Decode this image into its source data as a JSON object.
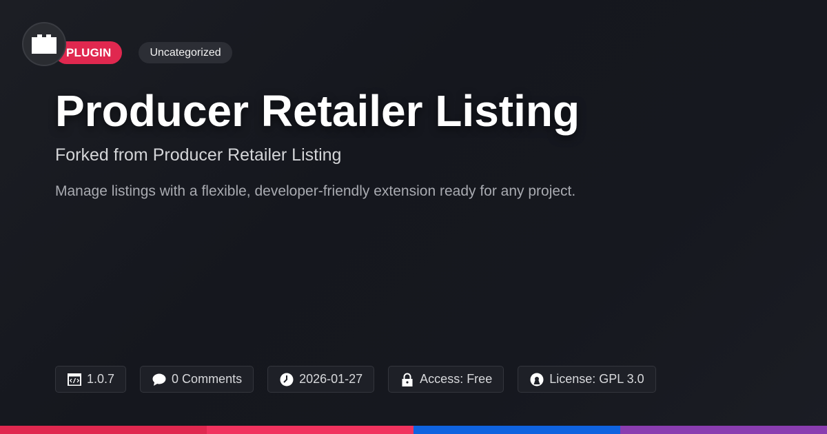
{
  "logo": {
    "icon": "plugin-block-icon"
  },
  "badges": {
    "type_label": "PLUGIN",
    "category_label": "Uncategorized"
  },
  "title": "Producer Retailer Listing",
  "subtitle": "Forked from Producer Retailer Listing",
  "description": "Manage listings with a flexible, developer-friendly extension ready for any project.",
  "meta": {
    "version": {
      "icon": "code-window-icon",
      "text": "1.0.7"
    },
    "comments": {
      "icon": "speech-bubble-icon",
      "text": "0 Comments"
    },
    "date": {
      "icon": "clock-icon",
      "text": "2026-01-27"
    },
    "access": {
      "icon": "lock-icon",
      "text": "Access: Free"
    },
    "license": {
      "icon": "open-source-icon",
      "text": "License: GPL 3.0"
    }
  },
  "colors": {
    "accent": "#e0284f",
    "bar": [
      "#e0284f",
      "#f1335e",
      "#0f63e0",
      "#8a3db0"
    ]
  }
}
